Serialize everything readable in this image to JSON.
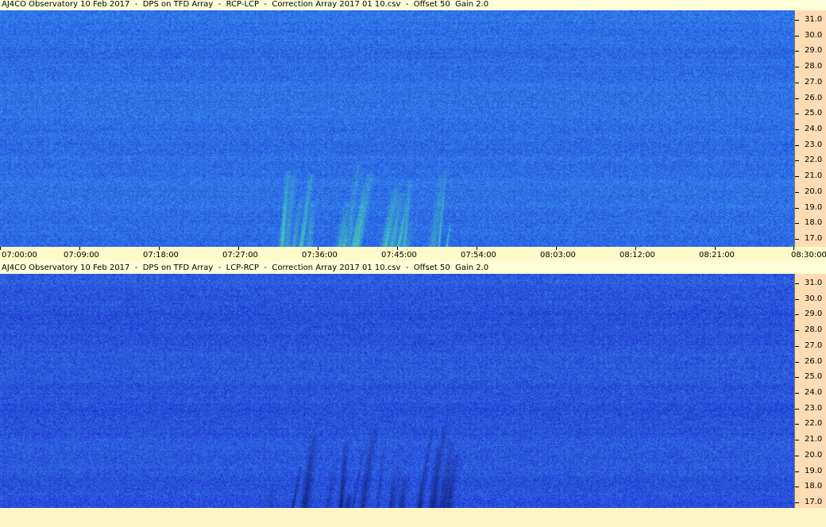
{
  "chart_data": [
    {
      "type": "heatmap",
      "title": "AJ4CO Observatory 10 Feb 2017  -  DPS on TFD Array  -  RCP-LCP  -  Correction Array 2017 01 10.csv  -  Offset 50  Gain 2.0",
      "polarization": "RCP-LCP",
      "x_ticks": [
        "07:00:00",
        "07:09:00",
        "07:18:00",
        "07:27:00",
        "07:36:00",
        "07:45:00",
        "07:54:00",
        "08:03:00",
        "08:12:00",
        "08:21:00",
        "08:30:00"
      ],
      "y_ticks": [
        "31.0",
        "30.0",
        "29.0",
        "28.0",
        "27.0",
        "26.0",
        "25.0",
        "24.0",
        "23.0",
        "22.0",
        "21.0",
        "20.0",
        "19.0",
        "18.0",
        "17.0"
      ],
      "xlim": [
        "07:00:00",
        "08:30:00"
      ],
      "ylim": [
        16.5,
        31.6
      ],
      "colors": {
        "background": "#2d6fe6",
        "emission": "#4ee0b0"
      }
    },
    {
      "type": "heatmap",
      "title": "AJ4CO Observatory 10 Feb 2017  -  DPS on TFD Array  -  LCP-RCP  -  Correction Array 2017 01 10.csv  -  Offset 50  Gain 2.0",
      "polarization": "LCP-RCP",
      "x_ticks": [],
      "y_ticks": [
        "31.0",
        "30.0",
        "29.0",
        "28.0",
        "27.0",
        "26.0",
        "25.0",
        "24.0",
        "23.0",
        "22.0",
        "21.0",
        "20.0",
        "19.0",
        "18.0",
        "17.0"
      ],
      "xlim": [
        "07:00:00",
        "08:30:00"
      ],
      "ylim": [
        16.5,
        31.6
      ],
      "colors": {
        "background": "#2a55dc",
        "emission": "#0d1a70"
      }
    }
  ]
}
